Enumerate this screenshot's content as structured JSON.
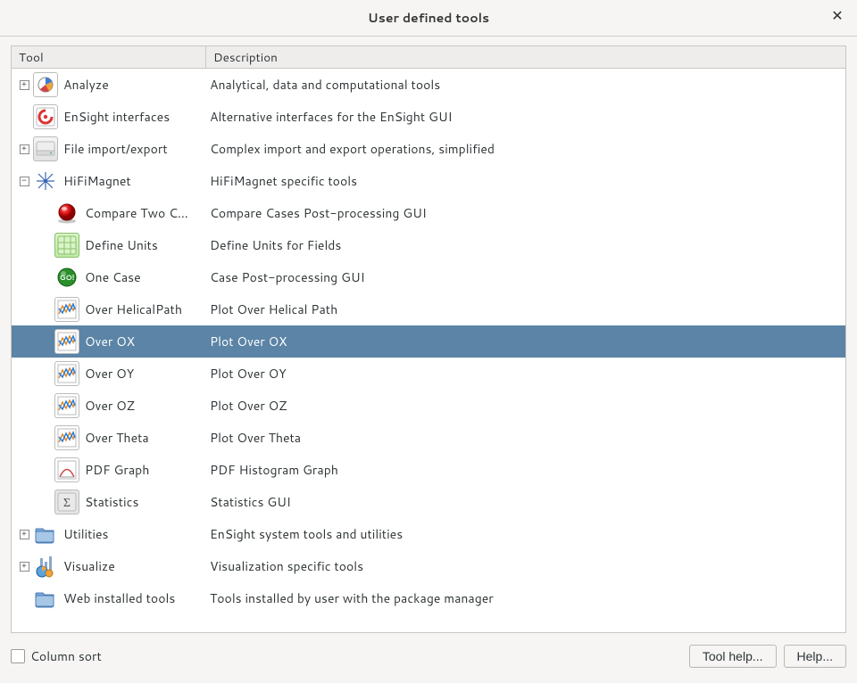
{
  "window": {
    "title": "User defined tools"
  },
  "columns": {
    "tool": "Tool",
    "description": "Description"
  },
  "rows": [
    {
      "level": 0,
      "expander": "plus",
      "icon": "analyze",
      "name": "Analyze",
      "desc": "Analytical, data and computational tools",
      "selected": false
    },
    {
      "level": 0,
      "expander": "none",
      "icon": "ensight",
      "name": "EnSight interfaces",
      "desc": "Alternative interfaces for the EnSight GUI",
      "selected": false
    },
    {
      "level": 0,
      "expander": "plus",
      "icon": "drive",
      "name": "File import/export",
      "desc": "Complex import and export operations, simplified",
      "selected": false
    },
    {
      "level": 0,
      "expander": "minus",
      "icon": "hifi",
      "name": "HiFiMagnet",
      "desc": "HiFiMagnet specific tools",
      "selected": false
    },
    {
      "level": 1,
      "expander": "none",
      "icon": "compare",
      "name": "Compare Two C…",
      "desc": "Compare Cases Post-processing GUI",
      "selected": false
    },
    {
      "level": 1,
      "expander": "none",
      "icon": "define",
      "name": "Define Units",
      "desc": "Define Units for Fields",
      "selected": false
    },
    {
      "level": 1,
      "expander": "none",
      "icon": "onecase",
      "name": "One Case",
      "desc": "Case Post-processing GUI",
      "selected": false
    },
    {
      "level": 1,
      "expander": "none",
      "icon": "plot",
      "name": "Over HelicalPath",
      "desc": "Plot Over Helical Path",
      "selected": false
    },
    {
      "level": 1,
      "expander": "none",
      "icon": "plot",
      "name": "Over OX",
      "desc": "Plot Over OX",
      "selected": true
    },
    {
      "level": 1,
      "expander": "none",
      "icon": "plot",
      "name": "Over OY",
      "desc": "Plot Over OY",
      "selected": false
    },
    {
      "level": 1,
      "expander": "none",
      "icon": "plot",
      "name": "Over OZ",
      "desc": "Plot Over OZ",
      "selected": false
    },
    {
      "level": 1,
      "expander": "none",
      "icon": "plot",
      "name": "Over Theta",
      "desc": "Plot Over Theta",
      "selected": false
    },
    {
      "level": 1,
      "expander": "none",
      "icon": "pdf",
      "name": "PDF Graph",
      "desc": "PDF Histogram Graph",
      "selected": false
    },
    {
      "level": 1,
      "expander": "none",
      "icon": "stats",
      "name": "Statistics",
      "desc": "Statistics GUI",
      "selected": false
    },
    {
      "level": 0,
      "expander": "plus",
      "icon": "folder",
      "name": "Utilities",
      "desc": "EnSight system tools and utilities",
      "selected": false
    },
    {
      "level": 0,
      "expander": "plus",
      "icon": "visual",
      "name": "Visualize",
      "desc": "Visualization specific tools",
      "selected": false
    },
    {
      "level": 0,
      "expander": "none",
      "icon": "folder",
      "name": "Web installed tools",
      "desc": "Tools installed by user with the package manager",
      "selected": false
    }
  ],
  "footer": {
    "column_sort_label": "Column sort",
    "tool_help_label": "Tool help...",
    "help_label": "Help..."
  }
}
